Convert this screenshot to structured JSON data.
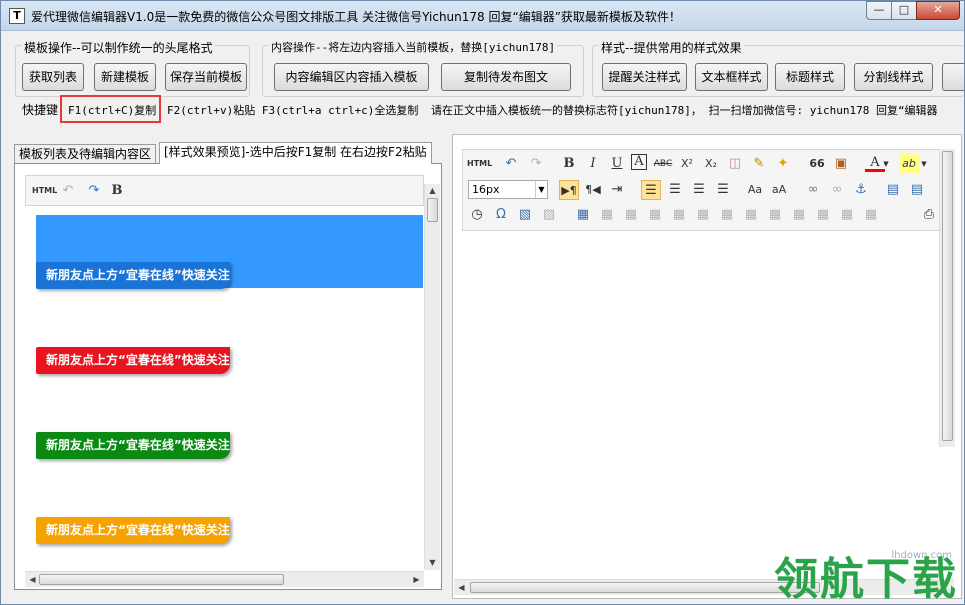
{
  "window": {
    "title": "爱代理微信编辑器V1.0是一款免费的微信公众号图文排版工具 关注微信号Yichun178 回复“编辑器”获取最新模板及软件！",
    "icon_letter": "T",
    "min": "—",
    "max": "□",
    "close": "✕"
  },
  "groups": {
    "template": {
      "legend": "模板操作--可以制作统一的头尾格式",
      "buttons": [
        "获取列表",
        "新建模板",
        "保存当前模板"
      ]
    },
    "content": {
      "legend": "内容操作--将左边内容插入当前模板，替换[yichun178]",
      "buttons": [
        "内容编辑区内容插入模板",
        "复制待发布图文"
      ]
    },
    "style": {
      "legend": "样式--提供常用的样式效果",
      "buttons": [
        "提醒关注样式",
        "文本框样式",
        "标题样式",
        "分割线样式"
      ]
    }
  },
  "shortcuts": {
    "label": "快捷键",
    "f1": "F1(ctrl+C)复制",
    "f2f3": "F2(ctrl+v)粘贴 F3(ctrl+a ctrl+c)全选复制",
    "note": "请在正文中插入模板统一的替换标志符[yichun178]， 扫一扫增加微信号: yichun178 回复“编辑器"
  },
  "tabs": {
    "tab1": "模板列表及待编辑内容区",
    "tab2": "[样式效果预览]-选中后按F1复制 在右边按F2粘贴"
  },
  "left_toolbar": {
    "html": "HTML",
    "bold": "B"
  },
  "preview": {
    "follow_text": "新朋友点上方“宜春在线”快速关注",
    "colors": {
      "blue_block": "#3399ff",
      "bar1": "#1a73d6",
      "bar2": "#e8141f",
      "bar3": "#0a8a12",
      "bar4": "#f5a300"
    }
  },
  "right_toolbar": {
    "html": "HTML",
    "fontsize": "16px",
    "bold": "B",
    "italic": "I",
    "underline": "U",
    "fontborder": "A",
    "strike": "ABC",
    "sup": "X²",
    "sub": "X₂",
    "quote": "66",
    "fontcolor": "A",
    "bgcolor": "ab",
    "omega": "Ω"
  },
  "watermark": {
    "text": "领航下载",
    "url": "lhdown.com"
  }
}
